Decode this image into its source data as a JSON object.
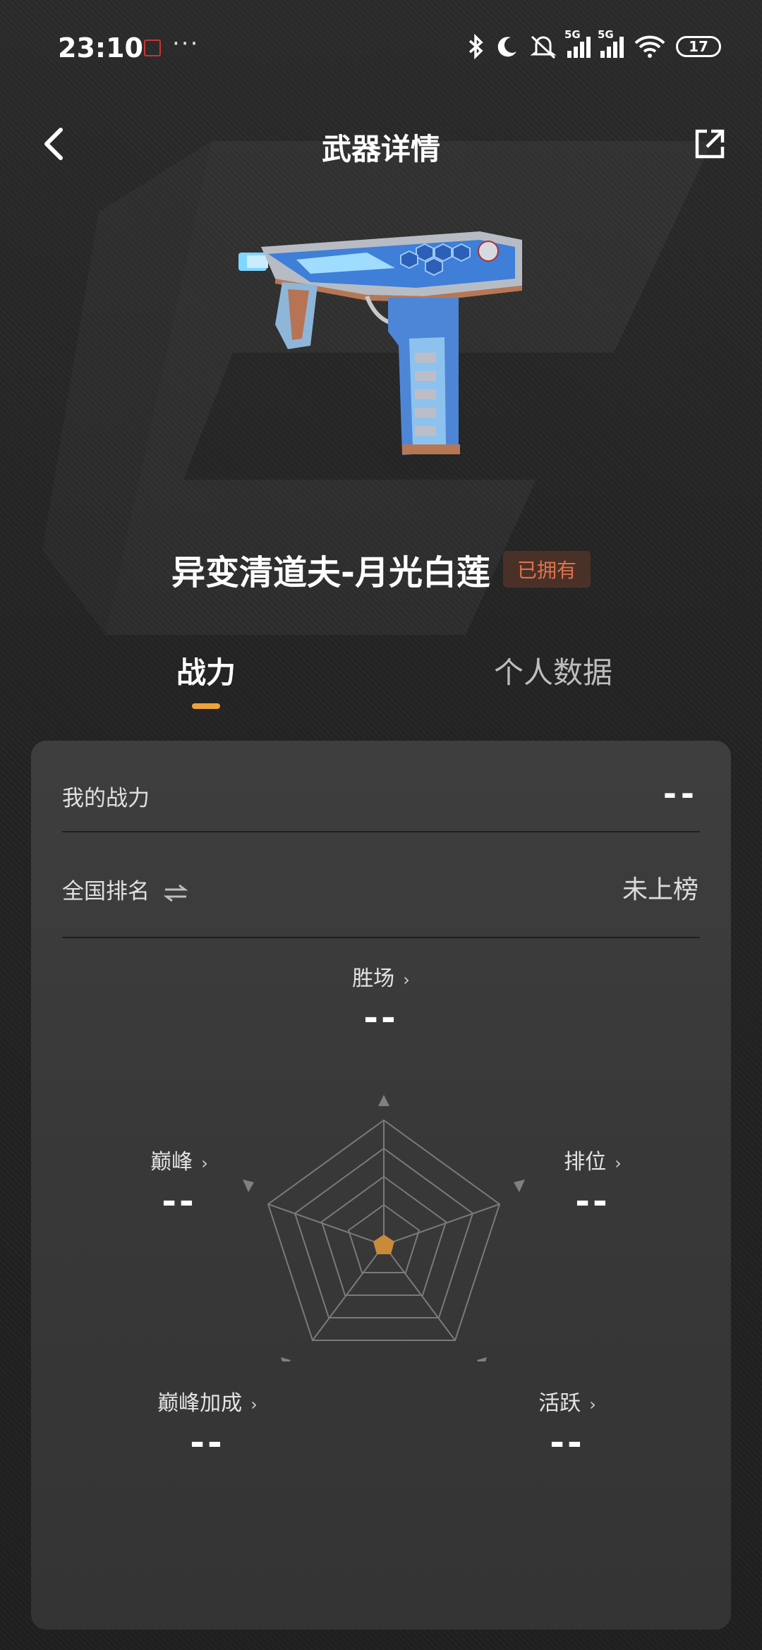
{
  "status_bar": {
    "time": "23:10",
    "more": "···",
    "signal_tag_1": "5G",
    "signal_tag_2": "5G",
    "wifi_tag": "6",
    "battery": "17"
  },
  "header": {
    "title": "武器详情"
  },
  "weapon": {
    "name": "异变清道夫-月光白莲",
    "badge": "已拥有"
  },
  "tabs": [
    {
      "label": "战力"
    },
    {
      "label": "个人数据"
    }
  ],
  "stats_card": {
    "power": {
      "label": "我的战力",
      "value": "--"
    },
    "rank": {
      "label": "全国排名",
      "value": "未上榜"
    },
    "radar": {
      "top": {
        "label": "胜场",
        "value": "--"
      },
      "left": {
        "label": "巅峰",
        "value": "--"
      },
      "right": {
        "label": "排位",
        "value": "--"
      },
      "bottom_left": {
        "label": "巅峰加成",
        "value": "--"
      },
      "bottom_right": {
        "label": "活跃",
        "value": "--"
      }
    }
  },
  "colors": {
    "accent": "#f0a33a",
    "badge_text": "#e0714c",
    "badge_bg": "#4a3127",
    "radar_fill": "#c98a3a"
  },
  "icons": [
    "back-icon",
    "share-icon",
    "swap-icon",
    "chevron-right-icon",
    "bluetooth-icon",
    "moon-icon",
    "bell-muted-icon",
    "wifi-icon",
    "battery-icon"
  ]
}
